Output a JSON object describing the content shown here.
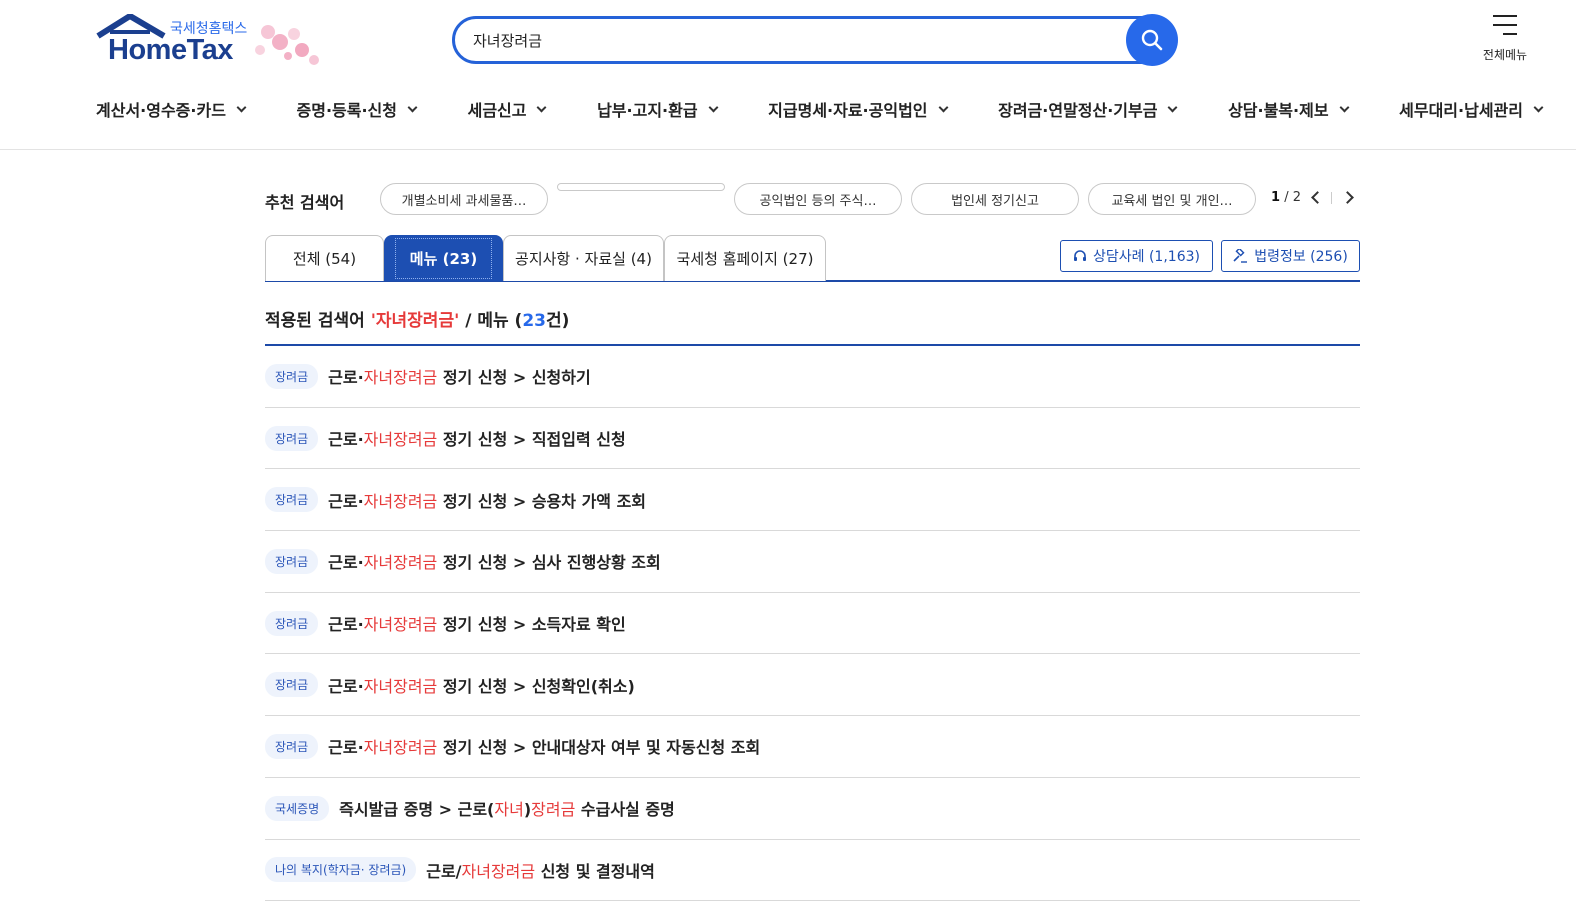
{
  "header": {
    "logo_sub": "국세청홈택스",
    "logo_main": "HomeTax",
    "search_value": "자녀장려금",
    "all_menu_label": "전체메뉴"
  },
  "gnb": [
    "계산서·영수증·카드",
    "증명·등록·신청",
    "세금신고",
    "납부·고지·환급",
    "지급명세·자료·공익법인",
    "장려금·연말정산·기부금",
    "상담·불복·제보",
    "세무대리·납세관리"
  ],
  "recommend": {
    "title": "추천 검색어",
    "chips": [
      "개별소비세 과세물품…",
      "",
      "공익법인 등의 주식…",
      "법인세 정기신고",
      "교육세 법인 및 개인…"
    ],
    "page_current": "1",
    "page_total": "/ 2"
  },
  "tabs": [
    "전체 (54)",
    "메뉴 (23)",
    "공지사항 · 자료실 (4)",
    "국세청 홈페이지 (27)"
  ],
  "side_buttons": {
    "consult": "상담사례 (1,163)",
    "law": "법령정보 (256)"
  },
  "result_head": {
    "prefix": "적용된 검색어 ",
    "keyword": "'자녀장려금'",
    "mid": " / 메뉴 (",
    "count": "23",
    "suffix": "건)"
  },
  "results": [
    {
      "badge": "장려금",
      "pre": "근로·",
      "hl": "자녀장려금",
      "post": " 정기 신청 > 신청하기"
    },
    {
      "badge": "장려금",
      "pre": "근로·",
      "hl": "자녀장려금",
      "post": " 정기 신청 > 직접입력 신청"
    },
    {
      "badge": "장려금",
      "pre": "근로·",
      "hl": "자녀장려금",
      "post": " 정기 신청 > 승용차 가액 조회"
    },
    {
      "badge": "장려금",
      "pre": "근로·",
      "hl": "자녀장려금",
      "post": " 정기 신청 > 심사 진행상황 조회"
    },
    {
      "badge": "장려금",
      "pre": "근로·",
      "hl": "자녀장려금",
      "post": " 정기 신청 > 소득자료 확인"
    },
    {
      "badge": "장려금",
      "pre": "근로·",
      "hl": "자녀장려금",
      "post": " 정기 신청 > 신청확인(취소)"
    },
    {
      "badge": "장려금",
      "pre": "근로·",
      "hl": "자녀장려금",
      "post": " 정기 신청 > 안내대상자 여부 및 자동신청 조회"
    },
    {
      "badge": "국세증명",
      "pre": "즉시발급 증명 > 근로(",
      "hl": "자녀",
      "mid": ")",
      "hl2": "장려금",
      "post": " 수급사실 증명"
    },
    {
      "badge": "나의 복지(학자금· 장려금)",
      "pre": "근로/",
      "hl": "자녀장려금",
      "post": " 신청 및 결정내역"
    }
  ]
}
